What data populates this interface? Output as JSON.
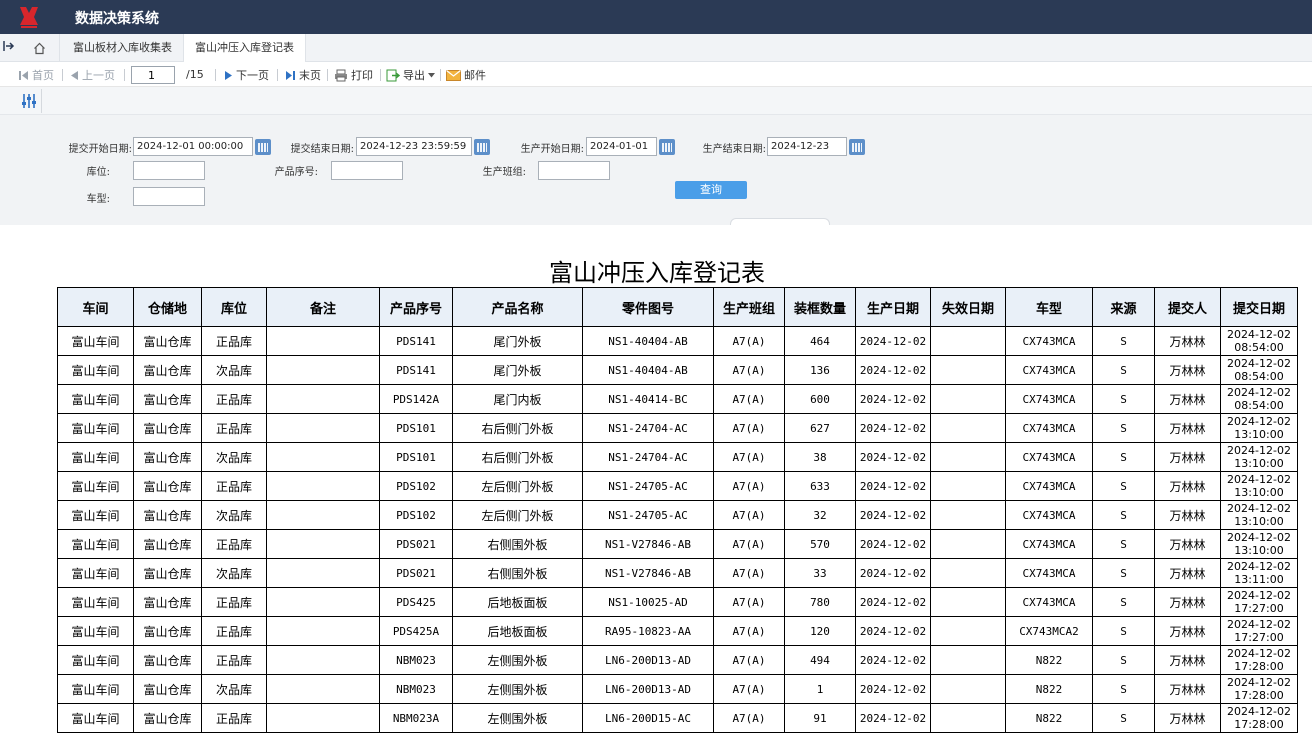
{
  "app": {
    "title": "数据决策系统"
  },
  "tabs": [
    {
      "label": "富山板材入库收集表"
    },
    {
      "label": "富山冲压入库登记表"
    }
  ],
  "toolbar": {
    "first": "首页",
    "prev": "上一页",
    "page_value": "1",
    "page_total": "/15",
    "next": "下一页",
    "last": "末页",
    "print": "打印",
    "export": "导出",
    "mail": "邮件"
  },
  "params": {
    "submit_start_label": "提交开始日期:",
    "submit_start_value": "2024-12-01 00:00:00",
    "submit_end_label": "提交结束日期:",
    "submit_end_value": "2024-12-23 23:59:59",
    "prod_start_label": "生产开始日期:",
    "prod_start_value": "2024-01-01",
    "prod_end_label": "生产结束日期:",
    "prod_end_value": "2024-12-23",
    "location_label": "库位:",
    "product_no_label": "产品序号:",
    "shift_label": "生产班组:",
    "model_label": "车型:",
    "query_label": "查询"
  },
  "report": {
    "title": "富山冲压入库登记表",
    "columns": [
      "车间",
      "仓储地",
      "库位",
      "备注",
      "产品序号",
      "产品名称",
      "零件图号",
      "生产班组",
      "装框数量",
      "生产日期",
      "失效日期",
      "车型",
      "来源",
      "提交人",
      "提交日期"
    ],
    "rows": [
      [
        "富山车间",
        "富山仓库",
        "正品库",
        "",
        "PDS141",
        "尾门外板",
        "NS1-40404-AB",
        "A7(A)",
        "464",
        "2024-12-02",
        "",
        "CX743MCA",
        "S",
        "万林林",
        "2024-12-02 08:54:00"
      ],
      [
        "富山车间",
        "富山仓库",
        "次品库",
        "",
        "PDS141",
        "尾门外板",
        "NS1-40404-AB",
        "A7(A)",
        "136",
        "2024-12-02",
        "",
        "CX743MCA",
        "S",
        "万林林",
        "2024-12-02 08:54:00"
      ],
      [
        "富山车间",
        "富山仓库",
        "正品库",
        "",
        "PDS142A",
        "尾门内板",
        "NS1-40414-BC",
        "A7(A)",
        "600",
        "2024-12-02",
        "",
        "CX743MCA",
        "S",
        "万林林",
        "2024-12-02 08:54:00"
      ],
      [
        "富山车间",
        "富山仓库",
        "正品库",
        "",
        "PDS101",
        "右后侧门外板",
        "NS1-24704-AC",
        "A7(A)",
        "627",
        "2024-12-02",
        "",
        "CX743MCA",
        "S",
        "万林林",
        "2024-12-02 13:10:00"
      ],
      [
        "富山车间",
        "富山仓库",
        "次品库",
        "",
        "PDS101",
        "右后侧门外板",
        "NS1-24704-AC",
        "A7(A)",
        "38",
        "2024-12-02",
        "",
        "CX743MCA",
        "S",
        "万林林",
        "2024-12-02 13:10:00"
      ],
      [
        "富山车间",
        "富山仓库",
        "正品库",
        "",
        "PDS102",
        "左后侧门外板",
        "NS1-24705-AC",
        "A7(A)",
        "633",
        "2024-12-02",
        "",
        "CX743MCA",
        "S",
        "万林林",
        "2024-12-02 13:10:00"
      ],
      [
        "富山车间",
        "富山仓库",
        "次品库",
        "",
        "PDS102",
        "左后侧门外板",
        "NS1-24705-AC",
        "A7(A)",
        "32",
        "2024-12-02",
        "",
        "CX743MCA",
        "S",
        "万林林",
        "2024-12-02 13:10:00"
      ],
      [
        "富山车间",
        "富山仓库",
        "正品库",
        "",
        "PDS021",
        "右侧围外板",
        "NS1-V27846-AB",
        "A7(A)",
        "570",
        "2024-12-02",
        "",
        "CX743MCA",
        "S",
        "万林林",
        "2024-12-02 13:10:00"
      ],
      [
        "富山车间",
        "富山仓库",
        "次品库",
        "",
        "PDS021",
        "右侧围外板",
        "NS1-V27846-AB",
        "A7(A)",
        "33",
        "2024-12-02",
        "",
        "CX743MCA",
        "S",
        "万林林",
        "2024-12-02 13:11:00"
      ],
      [
        "富山车间",
        "富山仓库",
        "正品库",
        "",
        "PDS425",
        "后地板面板",
        "NS1-10025-AD",
        "A7(A)",
        "780",
        "2024-12-02",
        "",
        "CX743MCA",
        "S",
        "万林林",
        "2024-12-02 17:27:00"
      ],
      [
        "富山车间",
        "富山仓库",
        "正品库",
        "",
        "PDS425A",
        "后地板面板",
        "RA95-10823-AA",
        "A7(A)",
        "120",
        "2024-12-02",
        "",
        "CX743MCA2",
        "S",
        "万林林",
        "2024-12-02 17:27:00"
      ],
      [
        "富山车间",
        "富山仓库",
        "正品库",
        "",
        "NBM023",
        "左侧围外板",
        "LN6-200D13-AD",
        "A7(A)",
        "494",
        "2024-12-02",
        "",
        "N822",
        "S",
        "万林林",
        "2024-12-02 17:28:00"
      ],
      [
        "富山车间",
        "富山仓库",
        "次品库",
        "",
        "NBM023",
        "左侧围外板",
        "LN6-200D13-AD",
        "A7(A)",
        "1",
        "2024-12-02",
        "",
        "N822",
        "S",
        "万林林",
        "2024-12-02 17:28:00"
      ],
      [
        "富山车间",
        "富山仓库",
        "正品库",
        "",
        "NBM023A",
        "左侧围外板",
        "LN6-200D15-AC",
        "A7(A)",
        "91",
        "2024-12-02",
        "",
        "N822",
        "S",
        "万林林",
        "2024-12-02 17:28:00"
      ]
    ]
  }
}
